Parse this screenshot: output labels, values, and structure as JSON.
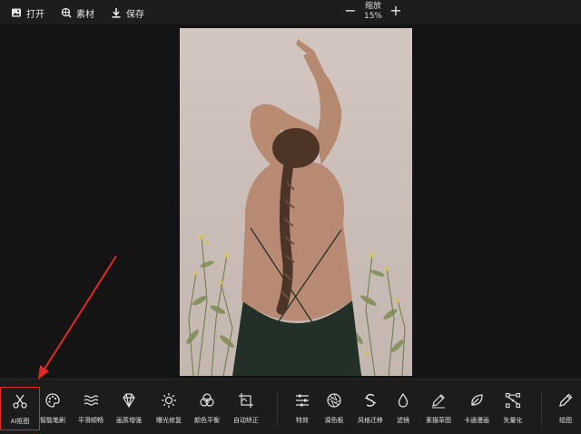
{
  "topbar": {
    "open_label": "打开",
    "assets_label": "素材",
    "save_label": "保存",
    "zoom_title": "缩放",
    "zoom_value": "15%",
    "zoom_minus": "−",
    "zoom_plus": "+"
  },
  "tools_left": [
    {
      "label": "AI抠图",
      "icon": "scissors-icon"
    },
    {
      "label": "智能笔刷",
      "icon": "palette-icon"
    },
    {
      "label": "平滑顺畅",
      "icon": "waves-icon"
    },
    {
      "label": "画质增强",
      "icon": "diamond-icon"
    },
    {
      "label": "曝光修复",
      "icon": "sun-icon"
    },
    {
      "label": "颜色平衡",
      "icon": "color-circles-icon"
    },
    {
      "label": "自动矫正",
      "icon": "crop-icon"
    }
  ],
  "tools_right": [
    {
      "label": "特效",
      "icon": "sliders-icon"
    },
    {
      "label": "调色板",
      "icon": "aperture-icon"
    },
    {
      "label": "风格迁移",
      "icon": "dollar-style-icon"
    },
    {
      "label": "滤镜",
      "icon": "drop-icon"
    },
    {
      "label": "素描草图",
      "icon": "pencil-sketch-icon"
    },
    {
      "label": "卡通漫画",
      "icon": "leaf-icon"
    },
    {
      "label": "矢量化",
      "icon": "vector-nodes-icon"
    }
  ],
  "tool_draw": {
    "label": "绘图",
    "icon": "pen-icon"
  },
  "colors": {
    "accent_red": "#e02a2a"
  }
}
